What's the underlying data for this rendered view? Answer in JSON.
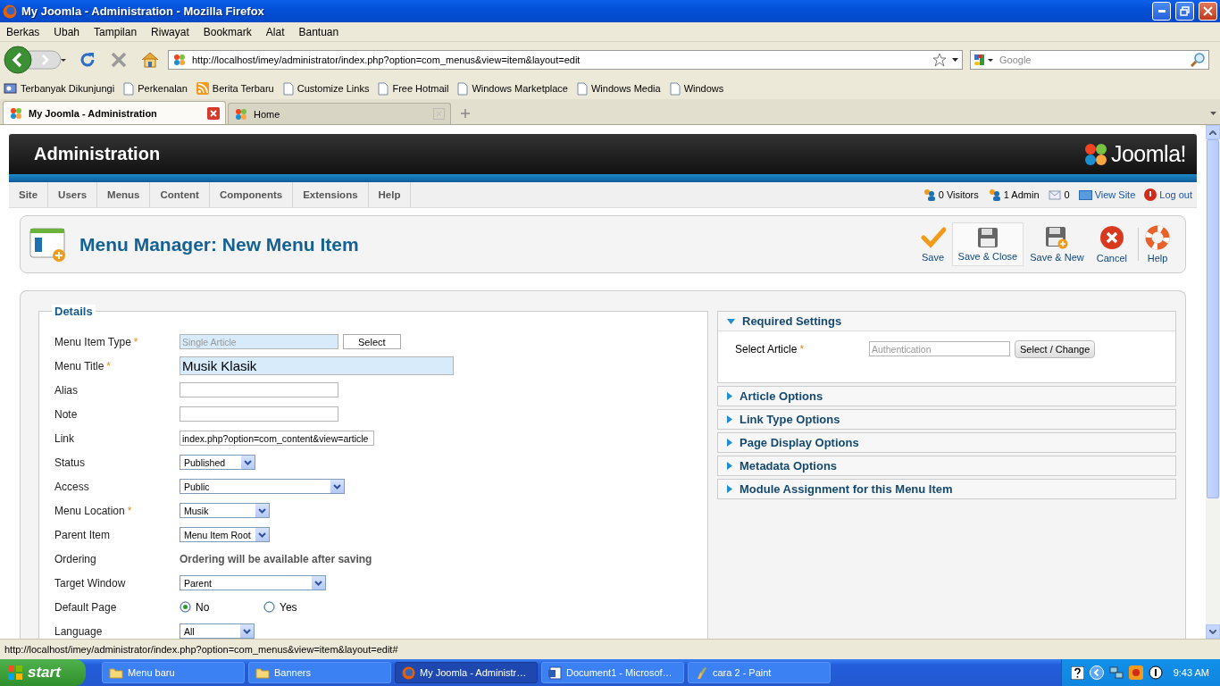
{
  "window": {
    "title": "My Joomla - Administration - Mozilla Firefox"
  },
  "menu": [
    "Berkas",
    "Ubah",
    "Tampilan",
    "Riwayat",
    "Bookmark",
    "Alat",
    "Bantuan"
  ],
  "address": {
    "value": "http://localhost/imey/administrator/index.php?option=com_menus&view=item&layout=edit"
  },
  "search": {
    "placeholder": "Google"
  },
  "bookmarks": [
    {
      "label": "Terbanyak Dikunjungi",
      "kind": "smart"
    },
    {
      "label": "Perkenalan",
      "kind": "page"
    },
    {
      "label": "Berita Terbaru",
      "kind": "feed"
    },
    {
      "label": "Customize Links",
      "kind": "page"
    },
    {
      "label": "Free Hotmail",
      "kind": "page"
    },
    {
      "label": "Windows Marketplace",
      "kind": "page"
    },
    {
      "label": "Windows Media",
      "kind": "page"
    },
    {
      "label": "Windows",
      "kind": "page"
    }
  ],
  "tabs": [
    {
      "label": "My Joomla - Administration",
      "selected": true
    },
    {
      "label": "Home",
      "selected": false
    }
  ],
  "page": {
    "brand": "Administration",
    "logo": "Joomla!",
    "nav": [
      "Site",
      "Users",
      "Menus",
      "Content",
      "Components",
      "Extensions",
      "Help"
    ],
    "status": [
      {
        "kind": "visitors",
        "label": "0 Visitors"
      },
      {
        "kind": "admin",
        "label": "1 Admin"
      },
      {
        "kind": "messages",
        "label": "0"
      },
      {
        "kind": "view",
        "label": "View Site"
      },
      {
        "kind": "logout",
        "label": "Log out"
      }
    ],
    "heading": "Menu Manager: New Menu Item",
    "actions": [
      {
        "kind": "save",
        "label": "Save",
        "hovered": false
      },
      {
        "kind": "save-close",
        "label": "Save & Close",
        "hovered": true
      },
      {
        "kind": "save-new",
        "label": "Save & New",
        "hovered": false
      },
      {
        "kind": "cancel",
        "label": "Cancel",
        "hovered": false
      },
      {
        "kind": "help",
        "label": "Help",
        "hovered": false
      }
    ],
    "details": {
      "legend": "Details",
      "fields": [
        {
          "kind": "picker",
          "label": "Menu Item Type",
          "mark": "*",
          "value": "Single Article",
          "disabled": true,
          "button": "Select"
        },
        {
          "kind": "title",
          "label": "Menu Title",
          "mark": "*",
          "value": "Musik Klasik"
        },
        {
          "kind": "text",
          "label": "Alias"
        },
        {
          "kind": "text",
          "label": "Note"
        },
        {
          "kind": "text",
          "label": "Link",
          "value": "index.php?option=com_content&view=article"
        },
        {
          "kind": "select",
          "label": "Status",
          "value": "Published"
        },
        {
          "kind": "select",
          "label": "Access",
          "value": "Public"
        },
        {
          "kind": "select",
          "label": "Menu Location",
          "mark": "*",
          "value": "Musik"
        },
        {
          "kind": "select",
          "label": "Parent Item",
          "value": "Menu Item Root"
        },
        {
          "kind": "static",
          "label": "Ordering",
          "value": "Ordering will be available after saving"
        },
        {
          "kind": "select",
          "label": "Target Window",
          "value": "Parent"
        },
        {
          "kind": "radio",
          "label": "Default Page",
          "options": [
            {
              "label": "No",
              "selected": true
            },
            {
              "label": "Yes",
              "selected": false
            }
          ]
        },
        {
          "kind": "select",
          "label": "Language",
          "value": "All"
        }
      ]
    },
    "panels": [
      {
        "title": "Required Settings",
        "expanded": true,
        "fields": [
          {
            "label": "Select Article",
            "mark": "*",
            "value": "Authentication",
            "disabled": true,
            "button": "Select / Change"
          }
        ]
      },
      {
        "title": "Article Options",
        "expanded": false
      },
      {
        "title": "Link Type Options",
        "expanded": false
      },
      {
        "title": "Page Display Options",
        "expanded": false
      },
      {
        "title": "Metadata Options",
        "expanded": false
      },
      {
        "title": "Module Assignment for this Menu Item",
        "expanded": false
      }
    ]
  },
  "status_bar": "http://localhost/imey/administrator/index.php?option=com_menus&view=item&layout=edit#",
  "taskbar": {
    "start": "start",
    "clock": "9:43 AM",
    "items": [
      {
        "kind": "folder",
        "label": "Menu baru",
        "selected": false
      },
      {
        "kind": "folder",
        "label": "Banners",
        "selected": false
      },
      {
        "kind": "browser",
        "label": "My Joomla - Administr…",
        "selected": true
      },
      {
        "kind": "document",
        "label": "Document1 - Microsof…",
        "selected": false
      },
      {
        "kind": "paint",
        "label": "cara 2 - Paint",
        "selected": false
      }
    ]
  }
}
